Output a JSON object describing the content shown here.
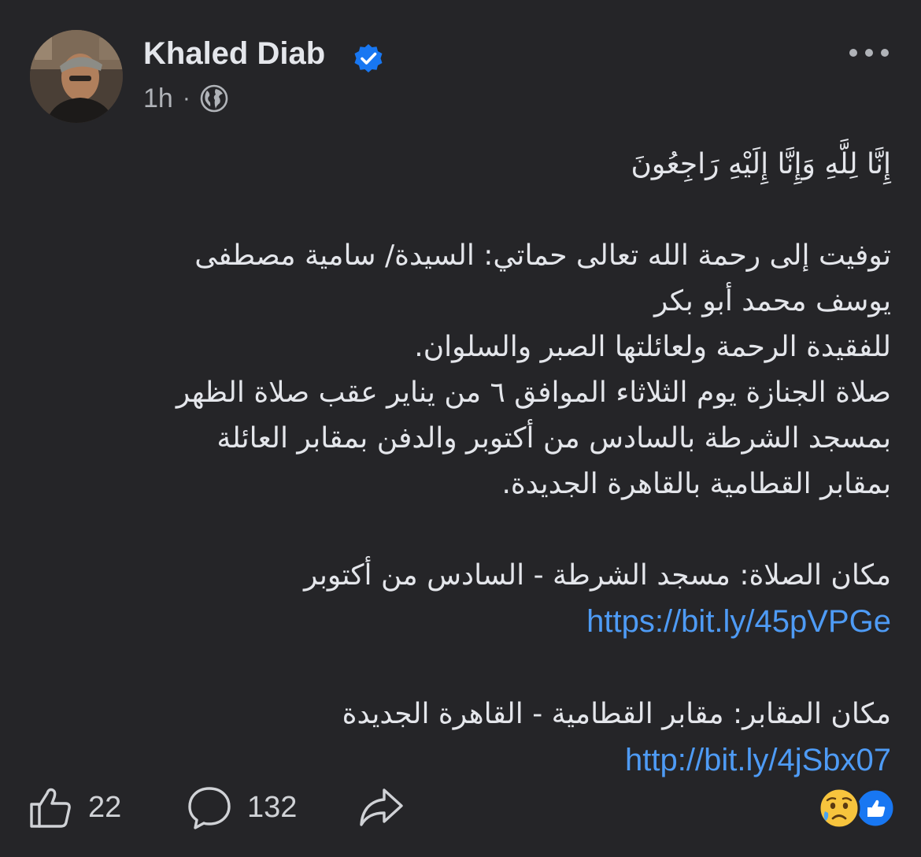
{
  "post": {
    "author": "Khaled Diab",
    "time": "1h",
    "separator": "·",
    "lines": {
      "l1": "إِنَّا لِلَّهِ وَإِنَّا إِلَيْهِ رَاجِعُونَ",
      "l2": "توفيت إلى رحمة الله تعالى حماتي: السيدة/ سامية مصطفى",
      "l3": "يوسف محمد أبو بكر",
      "l4": "للفقيدة الرحمة ولعائلتها الصبر والسلوان.",
      "l5": "صلاة الجنازة يوم الثلاثاء الموافق ٦ من يناير عقب صلاة الظهر",
      "l6": "بمسجد الشرطة بالسادس من أكتوبر والدفن بمقابر العائلة",
      "l7": "بمقابر القطامية بالقاهرة الجديدة.",
      "l8": "مكان الصلاة: مسجد الشرطة - السادس من أكتوبر",
      "link1": "https://bit.ly/45pVPGe",
      "l9": "مكان المقابر: مقابر القطامية - القاهرة الجديدة",
      "link2": "http://bit.ly/4jSbx07"
    }
  },
  "footer": {
    "likes": "22",
    "comments": "132"
  },
  "icons": {
    "verified": "verified-badge-icon",
    "privacy": "globe-icon",
    "more": "more-dots-icon",
    "like": "thumbs-up-icon",
    "comment": "comment-bubble-icon",
    "share": "share-arrow-icon",
    "reaction_sad": "sad-face-icon",
    "reaction_like": "like-reaction-icon"
  },
  "colors": {
    "background": "#252528",
    "text": "#e4e6eb",
    "link": "#4e9bf5",
    "verified": "#1877f2",
    "secondary": "#b0b3b8"
  }
}
